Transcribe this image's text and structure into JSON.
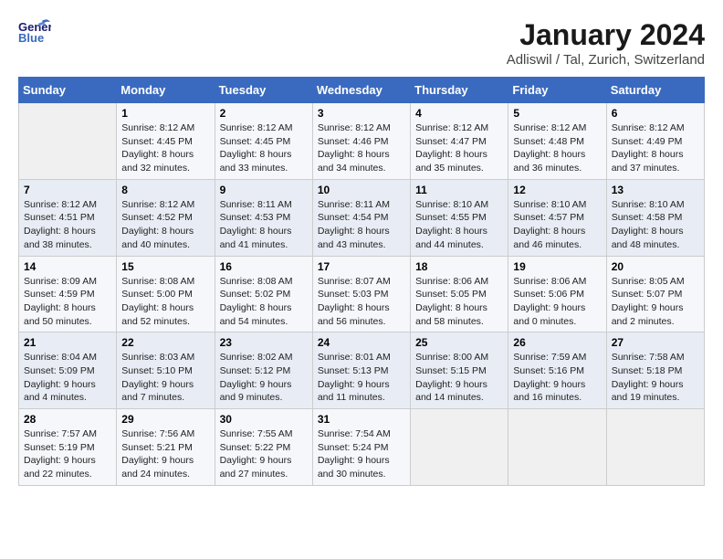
{
  "header": {
    "logo_general": "General",
    "logo_blue": "Blue",
    "title": "January 2024",
    "subtitle": "Adliswil / Tal, Zurich, Switzerland"
  },
  "weekdays": [
    "Sunday",
    "Monday",
    "Tuesday",
    "Wednesday",
    "Thursday",
    "Friday",
    "Saturday"
  ],
  "weeks": [
    [
      {
        "day": "",
        "info": ""
      },
      {
        "day": "1",
        "info": "Sunrise: 8:12 AM\nSunset: 4:45 PM\nDaylight: 8 hours\nand 32 minutes."
      },
      {
        "day": "2",
        "info": "Sunrise: 8:12 AM\nSunset: 4:45 PM\nDaylight: 8 hours\nand 33 minutes."
      },
      {
        "day": "3",
        "info": "Sunrise: 8:12 AM\nSunset: 4:46 PM\nDaylight: 8 hours\nand 34 minutes."
      },
      {
        "day": "4",
        "info": "Sunrise: 8:12 AM\nSunset: 4:47 PM\nDaylight: 8 hours\nand 35 minutes."
      },
      {
        "day": "5",
        "info": "Sunrise: 8:12 AM\nSunset: 4:48 PM\nDaylight: 8 hours\nand 36 minutes."
      },
      {
        "day": "6",
        "info": "Sunrise: 8:12 AM\nSunset: 4:49 PM\nDaylight: 8 hours\nand 37 minutes."
      }
    ],
    [
      {
        "day": "7",
        "info": "Sunrise: 8:12 AM\nSunset: 4:51 PM\nDaylight: 8 hours\nand 38 minutes."
      },
      {
        "day": "8",
        "info": "Sunrise: 8:12 AM\nSunset: 4:52 PM\nDaylight: 8 hours\nand 40 minutes."
      },
      {
        "day": "9",
        "info": "Sunrise: 8:11 AM\nSunset: 4:53 PM\nDaylight: 8 hours\nand 41 minutes."
      },
      {
        "day": "10",
        "info": "Sunrise: 8:11 AM\nSunset: 4:54 PM\nDaylight: 8 hours\nand 43 minutes."
      },
      {
        "day": "11",
        "info": "Sunrise: 8:10 AM\nSunset: 4:55 PM\nDaylight: 8 hours\nand 44 minutes."
      },
      {
        "day": "12",
        "info": "Sunrise: 8:10 AM\nSunset: 4:57 PM\nDaylight: 8 hours\nand 46 minutes."
      },
      {
        "day": "13",
        "info": "Sunrise: 8:10 AM\nSunset: 4:58 PM\nDaylight: 8 hours\nand 48 minutes."
      }
    ],
    [
      {
        "day": "14",
        "info": "Sunrise: 8:09 AM\nSunset: 4:59 PM\nDaylight: 8 hours\nand 50 minutes."
      },
      {
        "day": "15",
        "info": "Sunrise: 8:08 AM\nSunset: 5:00 PM\nDaylight: 8 hours\nand 52 minutes."
      },
      {
        "day": "16",
        "info": "Sunrise: 8:08 AM\nSunset: 5:02 PM\nDaylight: 8 hours\nand 54 minutes."
      },
      {
        "day": "17",
        "info": "Sunrise: 8:07 AM\nSunset: 5:03 PM\nDaylight: 8 hours\nand 56 minutes."
      },
      {
        "day": "18",
        "info": "Sunrise: 8:06 AM\nSunset: 5:05 PM\nDaylight: 8 hours\nand 58 minutes."
      },
      {
        "day": "19",
        "info": "Sunrise: 8:06 AM\nSunset: 5:06 PM\nDaylight: 9 hours\nand 0 minutes."
      },
      {
        "day": "20",
        "info": "Sunrise: 8:05 AM\nSunset: 5:07 PM\nDaylight: 9 hours\nand 2 minutes."
      }
    ],
    [
      {
        "day": "21",
        "info": "Sunrise: 8:04 AM\nSunset: 5:09 PM\nDaylight: 9 hours\nand 4 minutes."
      },
      {
        "day": "22",
        "info": "Sunrise: 8:03 AM\nSunset: 5:10 PM\nDaylight: 9 hours\nand 7 minutes."
      },
      {
        "day": "23",
        "info": "Sunrise: 8:02 AM\nSunset: 5:12 PM\nDaylight: 9 hours\nand 9 minutes."
      },
      {
        "day": "24",
        "info": "Sunrise: 8:01 AM\nSunset: 5:13 PM\nDaylight: 9 hours\nand 11 minutes."
      },
      {
        "day": "25",
        "info": "Sunrise: 8:00 AM\nSunset: 5:15 PM\nDaylight: 9 hours\nand 14 minutes."
      },
      {
        "day": "26",
        "info": "Sunrise: 7:59 AM\nSunset: 5:16 PM\nDaylight: 9 hours\nand 16 minutes."
      },
      {
        "day": "27",
        "info": "Sunrise: 7:58 AM\nSunset: 5:18 PM\nDaylight: 9 hours\nand 19 minutes."
      }
    ],
    [
      {
        "day": "28",
        "info": "Sunrise: 7:57 AM\nSunset: 5:19 PM\nDaylight: 9 hours\nand 22 minutes."
      },
      {
        "day": "29",
        "info": "Sunrise: 7:56 AM\nSunset: 5:21 PM\nDaylight: 9 hours\nand 24 minutes."
      },
      {
        "day": "30",
        "info": "Sunrise: 7:55 AM\nSunset: 5:22 PM\nDaylight: 9 hours\nand 27 minutes."
      },
      {
        "day": "31",
        "info": "Sunrise: 7:54 AM\nSunset: 5:24 PM\nDaylight: 9 hours\nand 30 minutes."
      },
      {
        "day": "",
        "info": ""
      },
      {
        "day": "",
        "info": ""
      },
      {
        "day": "",
        "info": ""
      }
    ]
  ]
}
